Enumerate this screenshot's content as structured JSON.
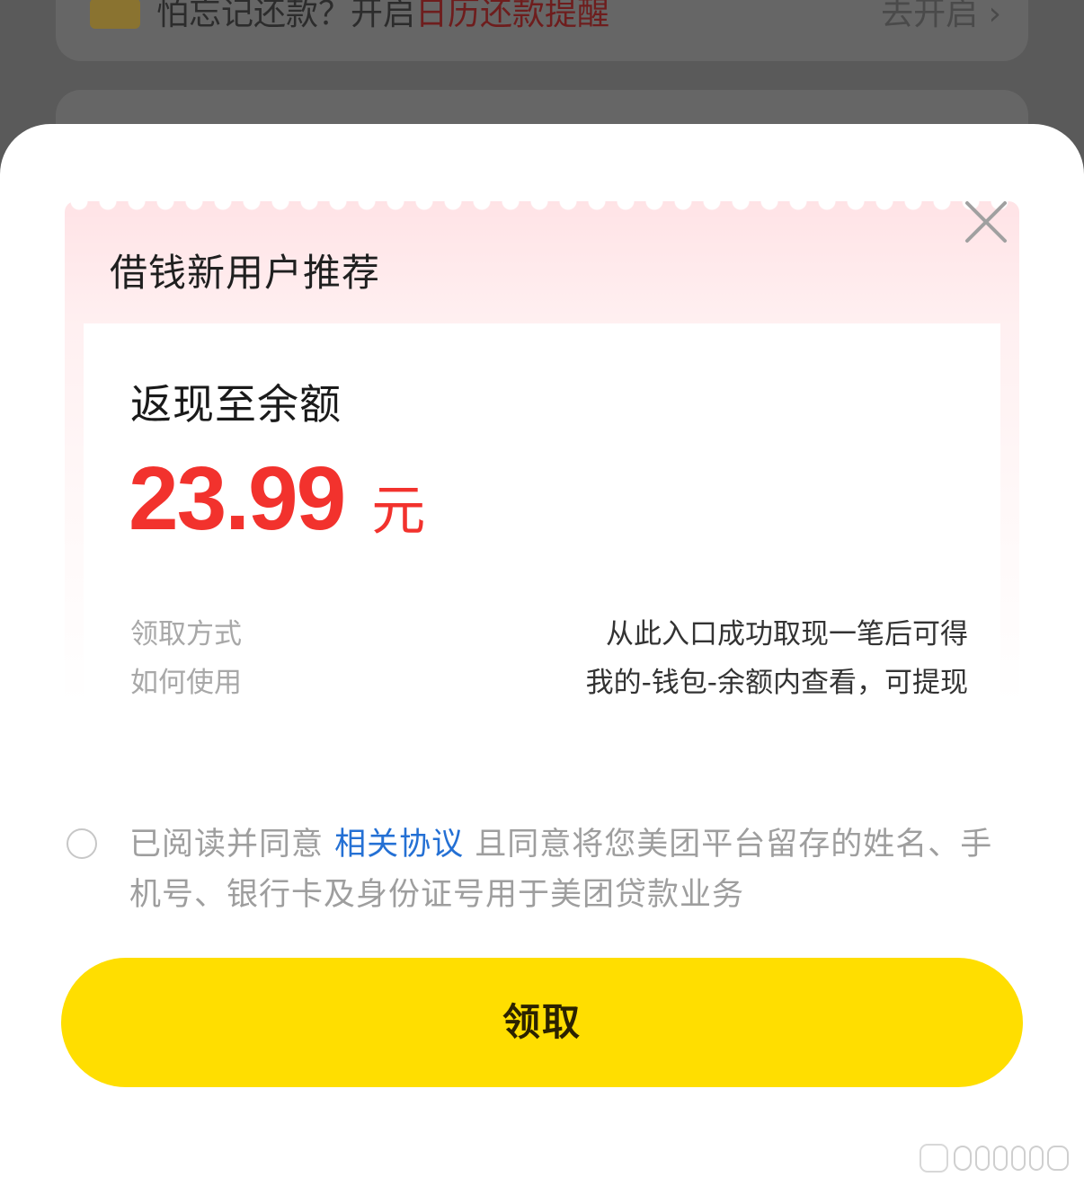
{
  "background": {
    "reminder": {
      "text_prefix": "怕忘记还款？开启",
      "text_highlight": "日历还款提醒",
      "action": "去开启 ›"
    }
  },
  "sheet": {
    "title": "借钱新用户推荐",
    "close_icon": "close-icon",
    "card": {
      "cashback_label": "返现至余额",
      "amount": "23.99",
      "unit": "元",
      "info": [
        {
          "label": "领取方式",
          "value": "从此入口成功取现一笔后可得"
        },
        {
          "label": "如何使用",
          "value": "我的-钱包-余额内查看，可提现"
        }
      ]
    },
    "agreement": {
      "prefix": "已阅读并同意 ",
      "link": "相关协议",
      "suffix": " 且同意将您美团平台留存的姓名、手机号、银行卡及身份证号用于美团贷款业务"
    },
    "claim_button": "领取"
  },
  "colors": {
    "accent_yellow": "#ffde00",
    "amount_red": "#f2322d",
    "link_blue": "#2470d4"
  }
}
